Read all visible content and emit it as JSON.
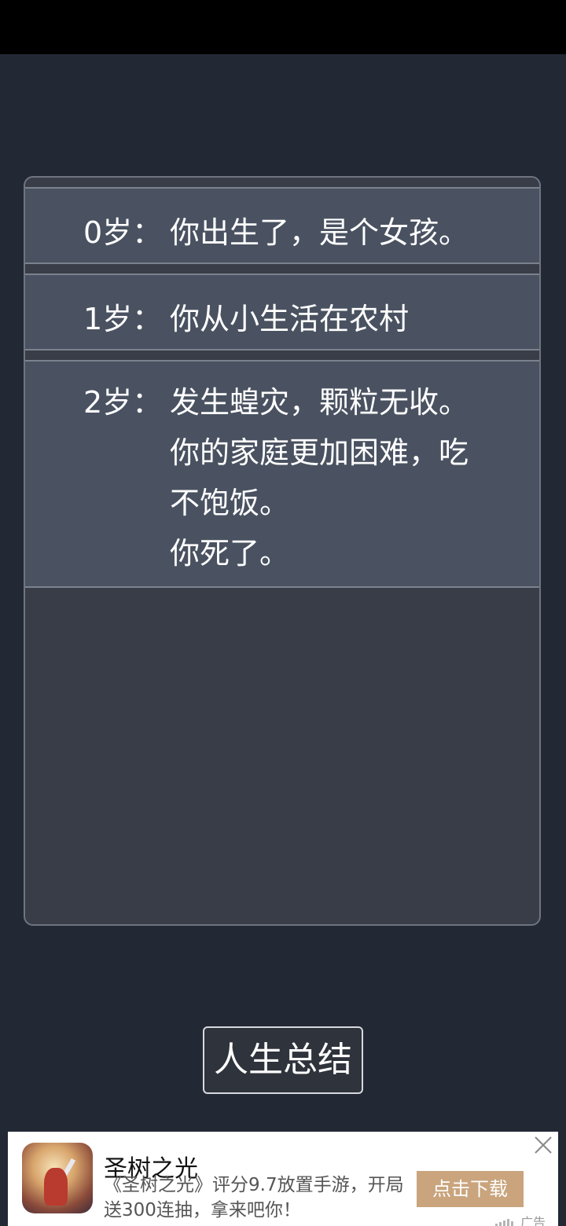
{
  "log": {
    "entries": [
      {
        "age": "0岁：",
        "lines": [
          "你出生了，是个女孩。"
        ]
      },
      {
        "age": "1岁：",
        "lines": [
          "你从小生活在农村"
        ]
      },
      {
        "age": "2岁：",
        "lines": [
          "发生蝗灾，颗粒无收。",
          "你的家庭更加困难，吃",
          "不饱饭。",
          "你死了。"
        ]
      }
    ]
  },
  "summary_button": {
    "label": "人生总结"
  },
  "ad": {
    "icon": "game-app-icon",
    "title": "圣树之光",
    "description_lines": [
      "《圣树之光》评分9.7放置手游，开局",
      "送300连抽，拿来吧你！"
    ],
    "cta_label": "点击下载",
    "ad_label": "广告",
    "cta_color": "#c9a47d"
  }
}
